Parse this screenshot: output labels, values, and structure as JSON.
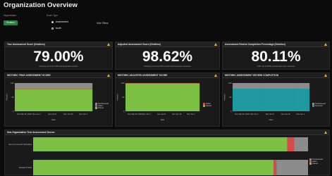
{
  "header": {
    "title": "Organization Overview",
    "org_label": "Organization",
    "org_value": "Dimitrov",
    "score_type_label": "Score Type",
    "score_options": [
      "Assessment",
      "Audit"
    ],
    "selected_option": "Assessment",
    "hide_filters": "Hide Filters"
  },
  "kpis": [
    {
      "title": "True Assessment Score (Dimitrov)",
      "value": "79.00%",
      "sub": "Passing out of the 3785 total applicable controls"
    },
    {
      "title": "Adjusted Assessment Score (Dimitrov)",
      "value": "98.62%",
      "sub": "Passing out of the 3787 controls that have been reviewed"
    },
    {
      "title": "Assessment Review Completion Percentage (Dimitrov)",
      "value": "80.11%",
      "sub": "3787 out of 3785 controls have been reviewed"
    }
  ],
  "charts": [
    {
      "title": "HISTORIC TRUE ASSESSMENT SCORE",
      "bar_color": "#6fae3f",
      "legend": [
        "Not Reviewed",
        "Failed",
        "Passed"
      ]
    },
    {
      "title": "HISTORIC ADJUSTED ASSESSMENT SCORE",
      "bar_color": "#6fae3f",
      "legend": [
        "Failed",
        "Passed"
      ]
    },
    {
      "title": "HISTORIC ASSESSMENT REVIEW COMPLETION",
      "bar_color": "#1f9aa0",
      "legend": [
        "Not Reviewed",
        "Reviewed"
      ]
    }
  ],
  "chart_common": {
    "y_ticks": [
      "100",
      "50",
      "0"
    ],
    "x_ticks": [
      "Nov Mar 20, 2022",
      "Nov Jun 1",
      "Nov Jun 8",
      "Nov Jun 15",
      "Nov Jun 1"
    ],
    "xlabel": "Date",
    "ylabel": "Percent"
  },
  "chart_data": [
    {
      "type": "bar",
      "title": "HISTORIC TRUE ASSESSMENT SCORE",
      "categories": [
        "Nov Mar 20, 2022",
        "Nov Jun 1",
        "Nov Jun 8",
        "Nov Jun 15",
        "Nov Jun 1"
      ],
      "series": [
        {
          "name": "Passed",
          "values": [
            79,
            79,
            79,
            79,
            79
          ]
        },
        {
          "name": "Failed",
          "values": [
            1,
            1,
            1,
            1,
            1
          ]
        },
        {
          "name": "Not Reviewed",
          "values": [
            20,
            20,
            20,
            20,
            20
          ]
        }
      ],
      "xlabel": "Date",
      "ylim": [
        0,
        100
      ]
    },
    {
      "type": "bar",
      "title": "HISTORIC ADJUSTED ASSESSMENT SCORE",
      "categories": [
        "Nov Mar 20, 2022",
        "Nov Jun 1",
        "Nov Jun 8",
        "Nov Jun 15",
        "Nov Jun 1"
      ],
      "series": [
        {
          "name": "Passed",
          "values": [
            98.6,
            98.6,
            98.6,
            98.6,
            98.6
          ]
        },
        {
          "name": "Failed",
          "values": [
            1.4,
            1.4,
            1.4,
            1.4,
            1.4
          ]
        }
      ],
      "xlabel": "Date",
      "ylim": [
        0,
        100
      ]
    },
    {
      "type": "bar",
      "title": "HISTORIC ASSESSMENT REVIEW COMPLETION",
      "categories": [
        "Nov Mar 20, 2022",
        "Nov Jun 1",
        "Nov Jun 8",
        "Nov Jun 15",
        "Nov Jun 1"
      ],
      "series": [
        {
          "name": "Reviewed",
          "values": [
            80,
            80,
            80,
            80,
            80
          ]
        },
        {
          "name": "Not Reviewed",
          "values": [
            20,
            20,
            20,
            20,
            20
          ]
        }
      ],
      "xlabel": "Date",
      "ylim": [
        0,
        100
      ]
    },
    {
      "type": "bar",
      "title": "Sub-Organization True Assessment Scores",
      "categories": [
        "Security Focused Subsidiary",
        "Standard TSAR"
      ],
      "series": [
        {
          "name": "Passed",
          "values": [
            92.5,
            87.5
          ]
        },
        {
          "name": "Failed",
          "values": [
            2.5,
            1.0
          ]
        },
        {
          "name": "Not Reviewed",
          "values": [
            5.0,
            11.5
          ]
        }
      ],
      "ylim": [
        0,
        100
      ]
    }
  ],
  "suborg": {
    "title": "Sub-Organization True Assessment Scores",
    "rows": [
      "Security Focused Subsidiary",
      "Standard TSAR"
    ],
    "legend": [
      "Not Reviewed",
      "Failed",
      "Passed"
    ]
  },
  "colors": {
    "passed": "#7cc043",
    "failed": "#d84a4a",
    "not_reviewed": "#8c8c8c",
    "teal": "#1f9aa0",
    "warn": "#e3b22c"
  }
}
